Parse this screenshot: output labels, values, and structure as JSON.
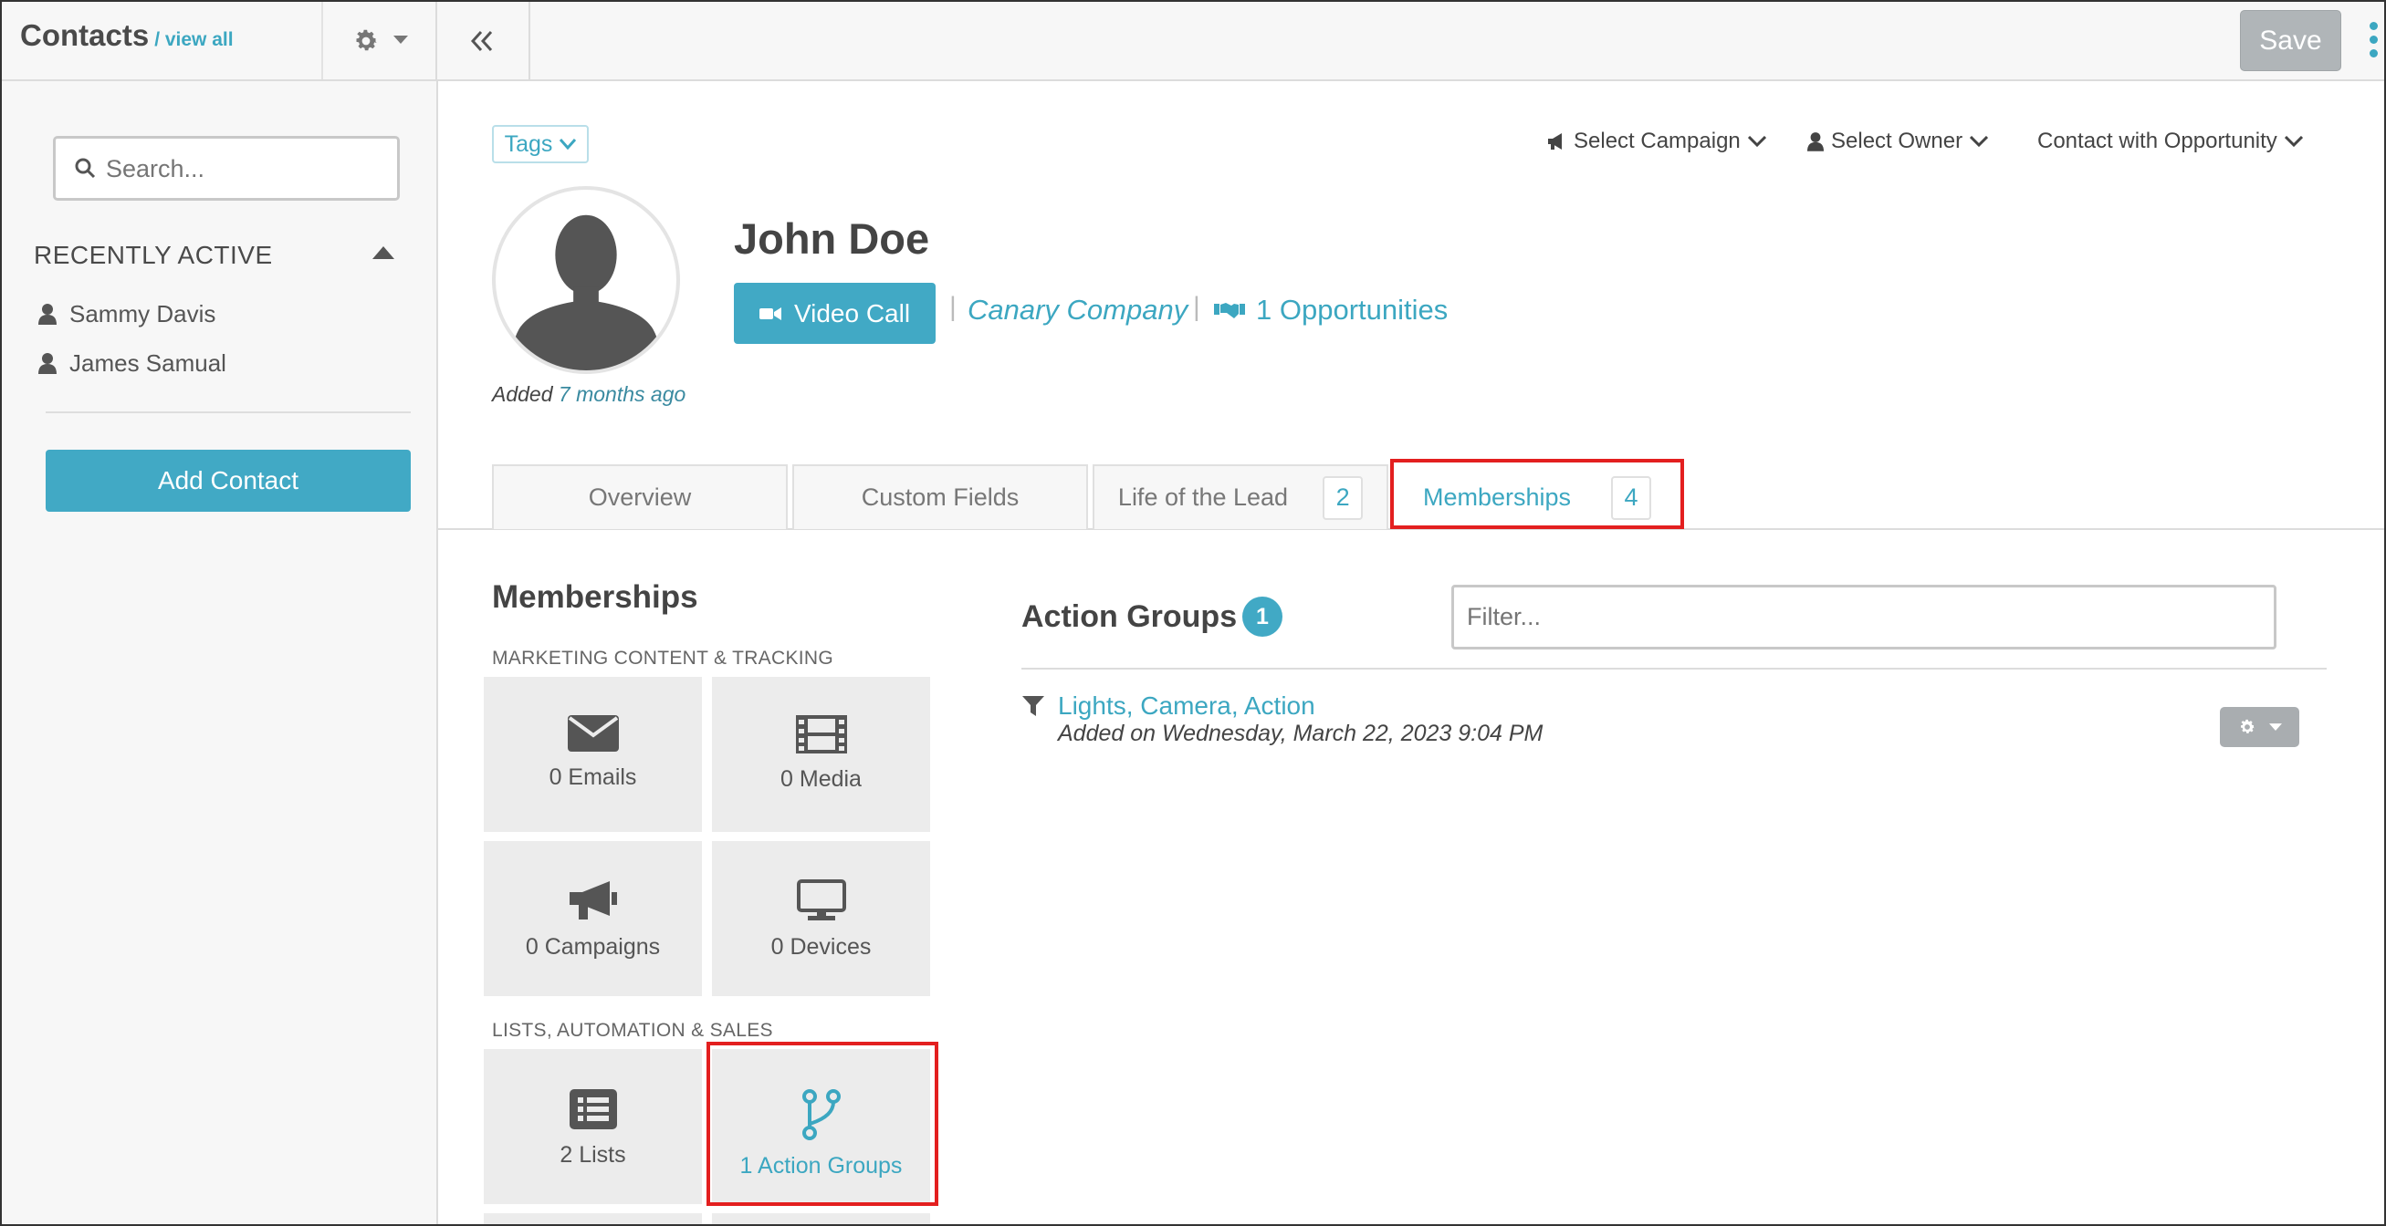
{
  "header": {
    "title": "Contacts",
    "view_all": "/ view all",
    "save_label": "Save"
  },
  "sidebar": {
    "search_placeholder": "Search...",
    "recent_header": "RECENTLY ACTIVE",
    "recent_items": [
      {
        "label": "Sammy Davis"
      },
      {
        "label": "James Samual"
      }
    ],
    "add_contact_label": "Add Contact"
  },
  "contact": {
    "tags_label": "Tags",
    "select_campaign": "Select Campaign",
    "select_owner": "Select Owner",
    "contact_with_opportunity": "Contact with Opportunity",
    "name": "John Doe",
    "added_prefix": "Added",
    "added_ago": "7 months ago",
    "video_call_label": "Video Call",
    "company": "Canary Company",
    "opportunities": "1 Opportunities"
  },
  "tabs": [
    {
      "label": "Overview"
    },
    {
      "label": "Custom Fields"
    },
    {
      "label": "Life of the Lead",
      "count": "2"
    },
    {
      "label": "Memberships",
      "count": "4",
      "active": true
    }
  ],
  "memberships": {
    "title": "Memberships",
    "section1": "MARKETING CONTENT & TRACKING",
    "section2": "LISTS, AUTOMATION & SALES",
    "tiles": [
      {
        "label": "0 Emails",
        "icon": "envelope-icon"
      },
      {
        "label": "0 Media",
        "icon": "film-icon"
      },
      {
        "label": "0 Campaigns",
        "icon": "megaphone-icon"
      },
      {
        "label": "0 Devices",
        "icon": "monitor-icon"
      },
      {
        "label": "2 Lists",
        "icon": "list-icon"
      },
      {
        "label": "1 Action Groups",
        "icon": "branch-icon",
        "active": true
      }
    ]
  },
  "action_groups": {
    "title": "Action Groups",
    "count": "1",
    "filter_placeholder": "Filter...",
    "items": [
      {
        "name": "Lights, Camera, Action",
        "added": "Added on Wednesday, March 22, 2023 9:04 PM"
      }
    ]
  },
  "colors": {
    "accent": "#41a9c5",
    "highlight": "#e31f1f",
    "save_disabled": "#b0b5b8"
  }
}
